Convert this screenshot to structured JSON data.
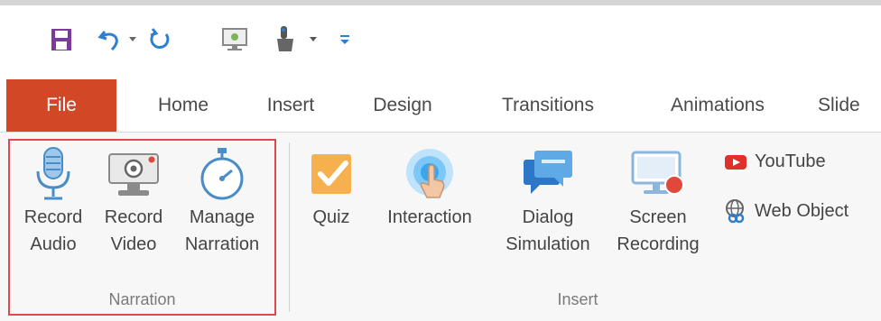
{
  "ribbon_tabs": [
    "File",
    "Home",
    "Insert",
    "Design",
    "Transitions",
    "Animations",
    "Slide"
  ],
  "narration_group": {
    "label": "Narration",
    "buttons": [
      {
        "line1": "Record",
        "line2": "Audio",
        "icon": "microphone-icon"
      },
      {
        "line1": "Record",
        "line2": "Video",
        "icon": "webcam-icon"
      },
      {
        "line1": "Manage",
        "line2": "Narration",
        "icon": "stopwatch-icon"
      }
    ]
  },
  "insert_group": {
    "label": "Insert",
    "buttons": [
      {
        "line1": "Quiz",
        "line2": "",
        "icon": "quiz-checkbox-icon"
      },
      {
        "line1": "Interaction",
        "line2": "",
        "icon": "touch-interaction-icon"
      },
      {
        "line1": "Dialog",
        "line2": "Simulation",
        "icon": "dialog-bubble-icon"
      },
      {
        "line1": "Screen",
        "line2": "Recording",
        "icon": "screen-record-icon"
      }
    ],
    "small_buttons": [
      {
        "label": "YouTube",
        "icon": "youtube-icon"
      },
      {
        "label": "Web Object",
        "icon": "globe-link-icon"
      }
    ]
  },
  "colors": {
    "file_tab": "#d24726",
    "highlight_border": "#e0484e",
    "accent_blue": "#2f7fd0"
  }
}
